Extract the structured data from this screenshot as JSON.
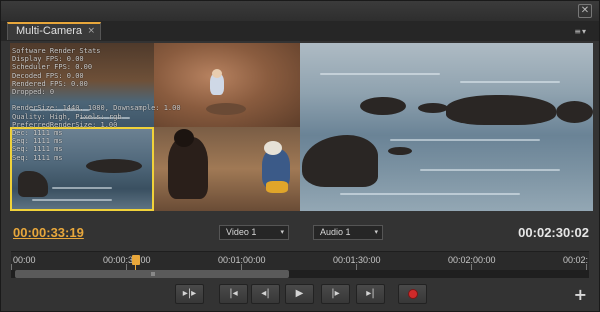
{
  "window": {
    "close_glyph": "✕"
  },
  "tab": {
    "label": "Multi-Camera",
    "close_glyph": "×"
  },
  "panel_menu": {
    "icon": "panel-menu-icon",
    "glyph": "≡",
    "arrow": "▾"
  },
  "overlay": {
    "text": "Software Render Stats\nDisplay FPS: 0.00\nScheduler FPS: 0.00\nDecoded FPS: 0.00\nRendered FPS: 0.00\nDropped: 0\n\nRenderSize: 1440, 1080, Downsample: 1.00\nQuality: High, Pixels: rgb\nPreferredRenderSize: 1.00\nDec: 1111 ms\nSeq: 1111 ms\nSeq: 1111 ms\nSeq: 1111 ms"
  },
  "timecode": {
    "current": "00:00:33:19",
    "duration": "00:02:30:02"
  },
  "selectors": {
    "video": "Video 1",
    "audio": "Audio 1",
    "caret": "▾"
  },
  "ruler": {
    "labels": [
      "00:00",
      "00:00:30:00",
      "00:01:00:00",
      "00:01:30:00",
      "00:02:00:00",
      "00:02:"
    ]
  },
  "transport": {
    "trim": "▸|▸",
    "prev_edit": "|◂",
    "step_back": "◂|",
    "play": "▶",
    "step_forward": "|▸",
    "next_edit": "▸|",
    "record": "record-icon"
  },
  "add_button": {
    "glyph": "+"
  },
  "colors": {
    "accent": "#e8a73b",
    "active_camera_border": "#f0d23a",
    "record": "#d12a2a"
  }
}
